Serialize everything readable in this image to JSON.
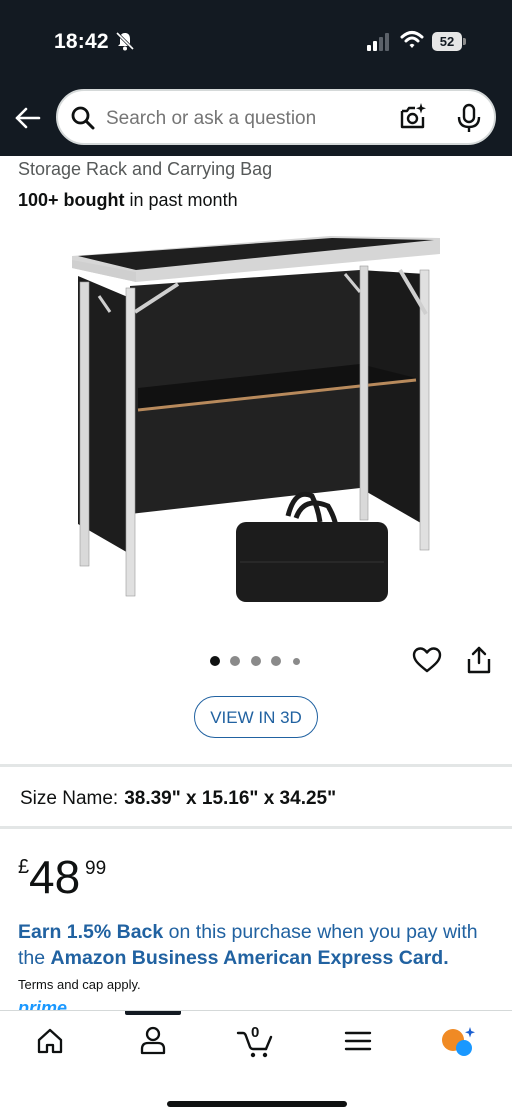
{
  "status_bar": {
    "time": "18:42",
    "battery": "52"
  },
  "search": {
    "placeholder": "Search or ask a question"
  },
  "product": {
    "title_line": "Storage Rack and Carrying Bag",
    "bought_bold": "100+ bought",
    "bought_rest": " in past month",
    "image_dots": 5,
    "active_dot": 0,
    "view_3d_label": "VIEW IN 3D",
    "size_label": "Size Name:",
    "size_value": "38.39\" x 15.16\" x 34.25\"",
    "price_currency": "£",
    "price_whole": "48",
    "price_fraction": "99"
  },
  "offer": {
    "bold1": "Earn 1.5% Back",
    "text1": " on this purchase when you pay with the ",
    "bold2": "Amazon Business American Express Card.",
    "terms": "Terms and cap apply.",
    "prime": "prime"
  },
  "nav": {
    "cart_count": "0"
  },
  "colors": {
    "header_bg": "#131a22",
    "link_blue": "#2162a1",
    "prime_blue": "#1a98ff",
    "rufus_orange": "#f08a24"
  }
}
